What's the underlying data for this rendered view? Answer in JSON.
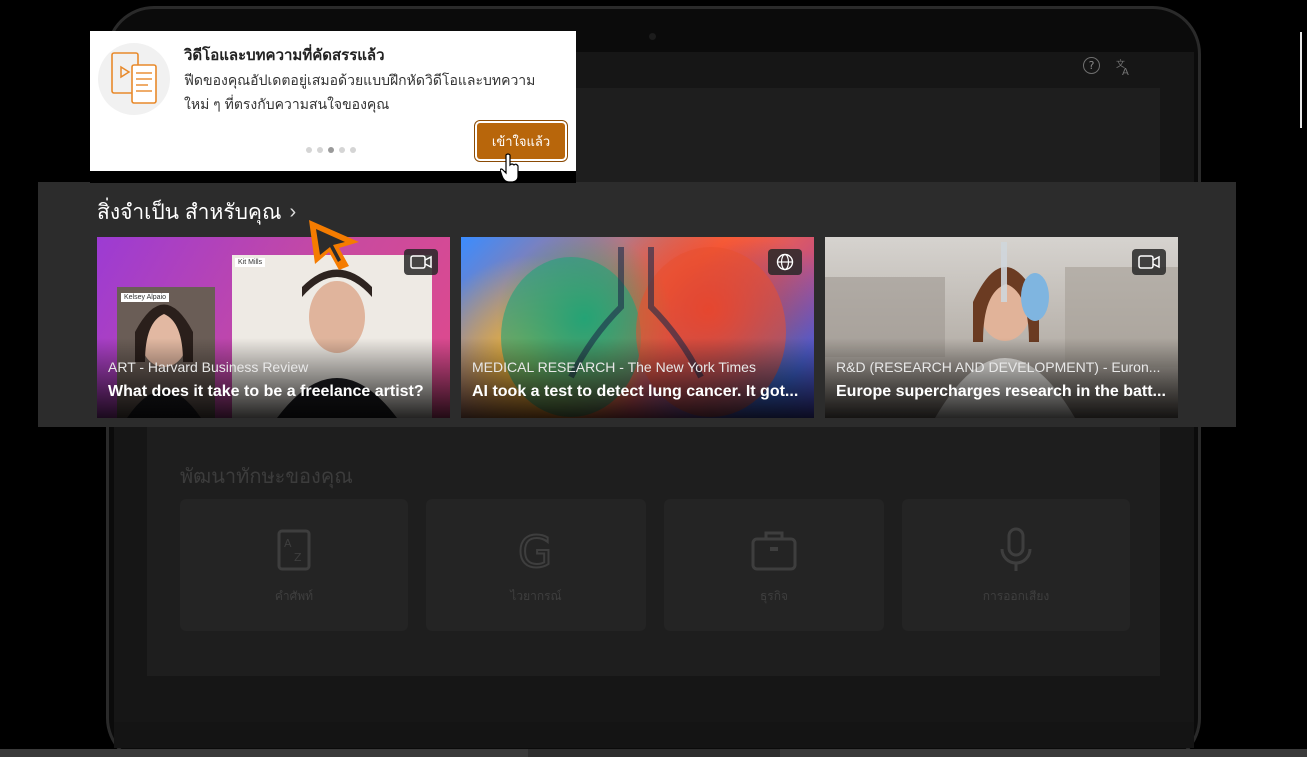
{
  "tooltip": {
    "title": "วิดีโอและบทความที่คัดสรรแล้ว",
    "body": "ฟีดของคุณอัปเดตอยู่เสมอด้วยแบบฝึกหัดวิดีโอและบทความใหม่ ๆ ที่ตรงกับความสนใจของคุณ",
    "button_label": "เข้าใจแล้ว",
    "dots_total": 5,
    "dot_active": 3
  },
  "header_icons": [
    "help-icon",
    "translate-icon"
  ],
  "essentials": {
    "title": "สิ่งจำเป็น สำหรับคุณ",
    "cards": [
      {
        "category": "ART - Harvard Business Review",
        "title": "What does it take to be a freelance artist?",
        "badge_icon": "video-icon",
        "overlay_texts": [
          "Kelsey Alpaio",
          "Kit Mills"
        ]
      },
      {
        "category": "MEDICAL RESEARCH - The New York Times",
        "title": "AI took a test to detect lung cancer. It got...",
        "badge_icon": "globe-icon"
      },
      {
        "category": "R&D (RESEARCH AND DEVELOPMENT) - Euron...",
        "title": "Europe supercharges research in the batt...",
        "badge_icon": "video-icon"
      }
    ]
  },
  "skills": {
    "title": "พัฒนาทักษะของคุณ",
    "items": [
      {
        "label": "คำศัพท์",
        "icon": "dictionary-icon"
      },
      {
        "label": "ไวยากรณ์",
        "icon": "grammar-icon"
      },
      {
        "label": "ธุรกิจ",
        "icon": "briefcase-icon"
      },
      {
        "label": "การออกเสียง",
        "icon": "microphone-icon"
      }
    ]
  },
  "colors": {
    "accent_button": "#b8660b",
    "pointer": "#f57c00"
  }
}
